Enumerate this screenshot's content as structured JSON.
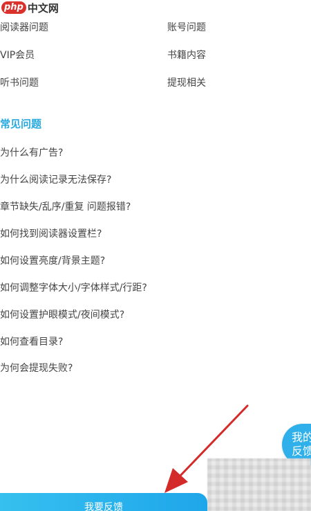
{
  "watermark": {
    "badge": "php",
    "text": "中文网"
  },
  "categories": [
    {
      "label": "阅读器问题"
    },
    {
      "label": "账号问题"
    },
    {
      "label": "VIP会员"
    },
    {
      "label": "书籍内容"
    },
    {
      "label": "听书问题"
    },
    {
      "label": "提现相关"
    }
  ],
  "faq": {
    "title": "常见问题",
    "items": [
      {
        "label": "为什么有广告?"
      },
      {
        "label": "为什么阅读记录无法保存?"
      },
      {
        "label": "章节缺失/乱序/重复 问题报错?"
      },
      {
        "label": "如何找到阅读器设置栏?"
      },
      {
        "label": "如何设置亮度/背景主题?"
      },
      {
        "label": "如何调整字体大小/字体样式/行距?"
      },
      {
        "label": "如何设置护眼模式/夜间模式?"
      },
      {
        "label": "如何查看目录?"
      },
      {
        "label": "为何会提现失败?"
      }
    ]
  },
  "floating_feedback": {
    "line1": "我的",
    "line2": "反馈"
  },
  "feedback_button": {
    "label": "我要反馈"
  },
  "colors": {
    "accent": "#27a9df",
    "button": "#1ea6ea",
    "annotation_arrow": "#d42a2a"
  }
}
